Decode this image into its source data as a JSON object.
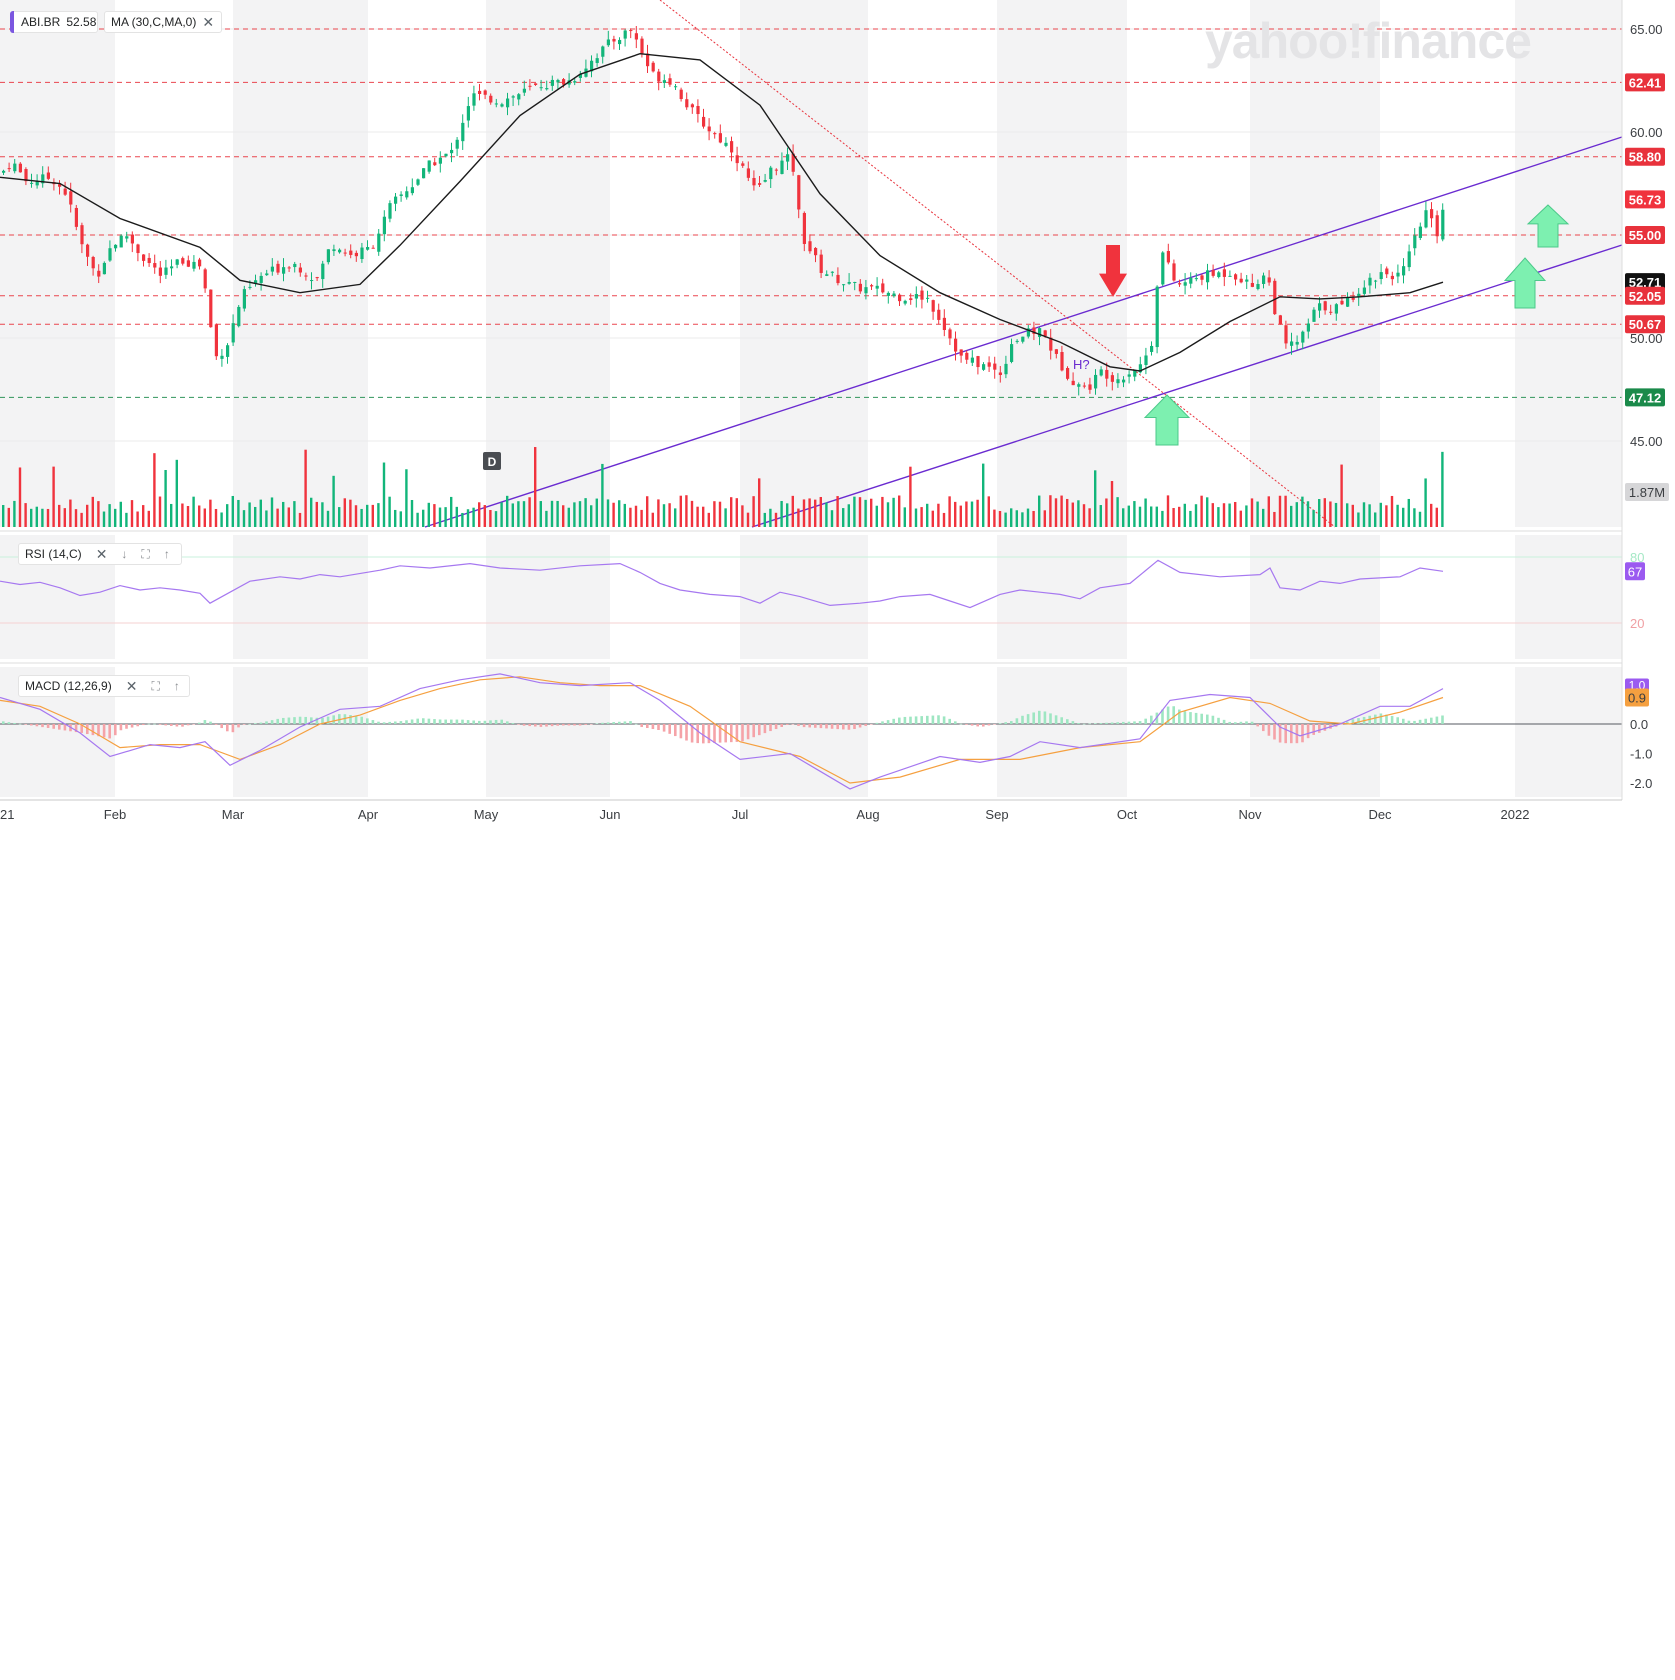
{
  "watermark": "yahoo!finance",
  "legends": {
    "symbol": "ABI.BR",
    "last_price": "52.58",
    "ma_label": "MA (30,C,MA,0)",
    "rsi_label": "RSI (14,C)",
    "macd_label": "MACD (12,26,9)"
  },
  "colors": {
    "up": "#12b57a",
    "down": "#f0333d",
    "ma": "#1b1b1b",
    "channel": "#6a2bd0",
    "resistance": "#e8323c",
    "support": "#1a8a4a",
    "rsi": "#a678f0",
    "macd": "#a678f0",
    "signal": "#f5a040",
    "accent": "#7b57e0"
  },
  "chart_data": [
    {
      "type": "candlestick",
      "title": "ABI.BR",
      "x": [
        "Feb",
        "Mar",
        "Apr",
        "May",
        "Jun",
        "Jul",
        "Aug",
        "Sep",
        "Oct",
        "Nov",
        "Dec",
        "2022"
      ],
      "x_first_label_fragment": "21",
      "y_ticks": [
        "45.00",
        "50.00",
        "55.00",
        "60.00",
        "65.00"
      ],
      "ylim": [
        43.5,
        65.8
      ],
      "close_path": [
        [
          0,
          58.0
        ],
        [
          10,
          58.6
        ],
        [
          25,
          57.6
        ],
        [
          50,
          57.8
        ],
        [
          65,
          57.0
        ],
        [
          80,
          54.5
        ],
        [
          95,
          53.0
        ],
        [
          110,
          54.5
        ],
        [
          125,
          55.0
        ],
        [
          140,
          54.0
        ],
        [
          160,
          53.0
        ],
        [
          180,
          53.8
        ],
        [
          200,
          53.5
        ],
        [
          208,
          51.0
        ],
        [
          213,
          49.0
        ],
        [
          225,
          49.6
        ],
        [
          240,
          52.0
        ],
        [
          260,
          53.0
        ],
        [
          290,
          53.7
        ],
        [
          315,
          52.8
        ],
        [
          330,
          54.6
        ],
        [
          350,
          54.0
        ],
        [
          370,
          54.4
        ],
        [
          390,
          56.5
        ],
        [
          410,
          57.4
        ],
        [
          430,
          58.5
        ],
        [
          450,
          59.0
        ],
        [
          470,
          61.8
        ],
        [
          500,
          61.5
        ],
        [
          540,
          62.3
        ],
        [
          570,
          62.5
        ],
        [
          590,
          63.5
        ],
        [
          610,
          64.4
        ],
        [
          630,
          65.0
        ],
        [
          650,
          62.8
        ],
        [
          670,
          62.5
        ],
        [
          690,
          61.0
        ],
        [
          710,
          60.0
        ],
        [
          730,
          59.2
        ],
        [
          755,
          57.0
        ],
        [
          770,
          58.2
        ],
        [
          790,
          58.8
        ],
        [
          800,
          55.0
        ],
        [
          820,
          53.3
        ],
        [
          850,
          52.5
        ],
        [
          880,
          52.3
        ],
        [
          900,
          52.0
        ],
        [
          925,
          52.0
        ],
        [
          940,
          50.8
        ],
        [
          960,
          49.0
        ],
        [
          980,
          48.7
        ],
        [
          1000,
          48.3
        ],
        [
          1010,
          49.8
        ],
        [
          1025,
          50.2
        ],
        [
          1040,
          50.4
        ],
        [
          1055,
          49.0
        ],
        [
          1070,
          48.0
        ],
        [
          1085,
          47.5
        ],
        [
          1100,
          48.4
        ],
        [
          1115,
          48.0
        ],
        [
          1140,
          48.7
        ],
        [
          1152,
          50.0
        ],
        [
          1158,
          54.5
        ],
        [
          1175,
          52.5
        ],
        [
          1200,
          53.0
        ],
        [
          1230,
          53.2
        ],
        [
          1250,
          52.5
        ],
        [
          1265,
          53.2
        ],
        [
          1275,
          51.0
        ],
        [
          1285,
          49.5
        ],
        [
          1300,
          50.0
        ],
        [
          1315,
          51.5
        ],
        [
          1340,
          51.5
        ],
        [
          1360,
          52.5
        ],
        [
          1380,
          53.2
        ],
        [
          1400,
          53.0
        ],
        [
          1415,
          55.0
        ],
        [
          1425,
          56.2
        ],
        [
          1435,
          55.0
        ],
        [
          1443,
          56.7
        ]
      ],
      "ma_path": [
        [
          0,
          57.8
        ],
        [
          60,
          57.5
        ],
        [
          120,
          55.8
        ],
        [
          200,
          54.4
        ],
        [
          240,
          52.8
        ],
        [
          300,
          52.2
        ],
        [
          360,
          52.6
        ],
        [
          400,
          54.5
        ],
        [
          460,
          57.6
        ],
        [
          520,
          60.8
        ],
        [
          580,
          62.8
        ],
        [
          640,
          63.8
        ],
        [
          700,
          63.5
        ],
        [
          760,
          61.3
        ],
        [
          820,
          57.0
        ],
        [
          880,
          54.0
        ],
        [
          940,
          52.2
        ],
        [
          1000,
          50.9
        ],
        [
          1060,
          49.8
        ],
        [
          1110,
          48.6
        ],
        [
          1140,
          48.4
        ],
        [
          1180,
          49.3
        ],
        [
          1230,
          50.8
        ],
        [
          1280,
          52.0
        ],
        [
          1320,
          51.9
        ],
        [
          1360,
          52.0
        ],
        [
          1410,
          52.2
        ],
        [
          1443,
          52.71
        ]
      ],
      "level_lines": [
        "65.00",
        "62.41",
        "58.80",
        "55.00",
        "52.05",
        "50.67",
        "47.12"
      ],
      "price_badges": [
        {
          "label": "62.41",
          "value": 62.41,
          "kind": "resistance"
        },
        {
          "label": "58.80",
          "value": 58.8,
          "kind": "resistance"
        },
        {
          "label": "56.73",
          "value": 56.73,
          "kind": "last"
        },
        {
          "label": "55.00",
          "value": 55.0,
          "kind": "resistance"
        },
        {
          "label": "52.71",
          "value": 52.71,
          "kind": "ma"
        },
        {
          "label": "52.05",
          "value": 52.05,
          "kind": "resistance"
        },
        {
          "label": "50.67",
          "value": 50.67,
          "kind": "resistance"
        },
        {
          "label": "47.12",
          "value": 47.12,
          "kind": "support"
        }
      ],
      "annotations": {
        "pattern_label": "H?",
        "dividend_marker": "D",
        "volume_label": "1.87M"
      }
    },
    {
      "type": "line",
      "title": "RSI (14,C)",
      "y_ticks": [
        "80",
        "20"
      ],
      "ylim": [
        5,
        95
      ],
      "last_value": "67",
      "series": [
        {
          "name": "RSI (14,C)",
          "points": [
            [
              0,
              58
            ],
            [
              20,
              55
            ],
            [
              40,
              57
            ],
            [
              60,
              52
            ],
            [
              80,
              45
            ],
            [
              100,
              48
            ],
            [
              120,
              54
            ],
            [
              140,
              50
            ],
            [
              160,
              52
            ],
            [
              180,
              50
            ],
            [
              200,
              47
            ],
            [
              210,
              38
            ],
            [
              230,
              48
            ],
            [
              250,
              58
            ],
            [
              280,
              62
            ],
            [
              300,
              60
            ],
            [
              320,
              64
            ],
            [
              340,
              62
            ],
            [
              380,
              68
            ],
            [
              400,
              72
            ],
            [
              430,
              70
            ],
            [
              470,
              74
            ],
            [
              500,
              70
            ],
            [
              540,
              68
            ],
            [
              580,
              72
            ],
            [
              620,
              74
            ],
            [
              640,
              66
            ],
            [
              660,
              56
            ],
            [
              680,
              50
            ],
            [
              710,
              46
            ],
            [
              740,
              44
            ],
            [
              760,
              38
            ],
            [
              780,
              48
            ],
            [
              800,
              44
            ],
            [
              830,
              36
            ],
            [
              860,
              38
            ],
            [
              880,
              40
            ],
            [
              900,
              44
            ],
            [
              930,
              46
            ],
            [
              950,
              40
            ],
            [
              970,
              34
            ],
            [
              1000,
              46
            ],
            [
              1020,
              50
            ],
            [
              1040,
              48
            ],
            [
              1060,
              46
            ],
            [
              1080,
              42
            ],
            [
              1100,
              52
            ],
            [
              1130,
              56
            ],
            [
              1158,
              77
            ],
            [
              1180,
              66
            ],
            [
              1220,
              62
            ],
            [
              1260,
              64
            ],
            [
              1270,
              70
            ],
            [
              1280,
              52
            ],
            [
              1300,
              50
            ],
            [
              1320,
              58
            ],
            [
              1340,
              56
            ],
            [
              1360,
              60
            ],
            [
              1400,
              62
            ],
            [
              1420,
              70
            ],
            [
              1443,
              67
            ]
          ]
        }
      ]
    },
    {
      "type": "line",
      "title": "MACD (12,26,9)",
      "y_ticks": [
        "0.0",
        "-1.0",
        "-2.0"
      ],
      "ylim": [
        -2.4,
        1.8
      ],
      "last_values": {
        "macd": "1.0",
        "signal": "0.9"
      },
      "series": [
        {
          "name": "MACD",
          "points": [
            [
              0,
              0.9
            ],
            [
              40,
              0.5
            ],
            [
              80,
              -0.3
            ],
            [
              110,
              -1.1
            ],
            [
              150,
              -0.7
            ],
            [
              180,
              -0.8
            ],
            [
              205,
              -0.6
            ],
            [
              230,
              -1.4
            ],
            [
              260,
              -0.9
            ],
            [
              300,
              -0.1
            ],
            [
              340,
              0.5
            ],
            [
              380,
              0.6
            ],
            [
              420,
              1.2
            ],
            [
              460,
              1.5
            ],
            [
              500,
              1.7
            ],
            [
              540,
              1.4
            ],
            [
              580,
              1.3
            ],
            [
              630,
              1.4
            ],
            [
              660,
              0.8
            ],
            [
              700,
              -0.3
            ],
            [
              740,
              -1.2
            ],
            [
              790,
              -1.0
            ],
            [
              820,
              -1.6
            ],
            [
              850,
              -2.2
            ],
            [
              880,
              -1.8
            ],
            [
              940,
              -1.1
            ],
            [
              980,
              -1.3
            ],
            [
              1010,
              -1.1
            ],
            [
              1040,
              -0.6
            ],
            [
              1080,
              -0.8
            ],
            [
              1140,
              -0.5
            ],
            [
              1170,
              0.8
            ],
            [
              1210,
              1.0
            ],
            [
              1250,
              0.9
            ],
            [
              1280,
              -0.1
            ],
            [
              1300,
              -0.4
            ],
            [
              1340,
              0.0
            ],
            [
              1380,
              0.6
            ],
            [
              1410,
              0.6
            ],
            [
              1443,
              1.2
            ]
          ]
        },
        {
          "name": "Signal",
          "points": [
            [
              0,
              0.8
            ],
            [
              40,
              0.6
            ],
            [
              80,
              0.0
            ],
            [
              120,
              -0.8
            ],
            [
              160,
              -0.7
            ],
            [
              200,
              -0.7
            ],
            [
              240,
              -1.2
            ],
            [
              280,
              -0.7
            ],
            [
              320,
              0.0
            ],
            [
              360,
              0.3
            ],
            [
              400,
              0.8
            ],
            [
              440,
              1.2
            ],
            [
              480,
              1.5
            ],
            [
              520,
              1.6
            ],
            [
              560,
              1.4
            ],
            [
              600,
              1.3
            ],
            [
              640,
              1.3
            ],
            [
              690,
              0.6
            ],
            [
              740,
              -0.6
            ],
            [
              800,
              -1.1
            ],
            [
              850,
              -2.0
            ],
            [
              900,
              -1.8
            ],
            [
              960,
              -1.2
            ],
            [
              1020,
              -1.2
            ],
            [
              1080,
              -0.8
            ],
            [
              1140,
              -0.6
            ],
            [
              1180,
              0.4
            ],
            [
              1230,
              0.9
            ],
            [
              1270,
              0.7
            ],
            [
              1310,
              0.1
            ],
            [
              1350,
              0.0
            ],
            [
              1400,
              0.4
            ],
            [
              1443,
              0.9
            ]
          ]
        }
      ]
    }
  ]
}
